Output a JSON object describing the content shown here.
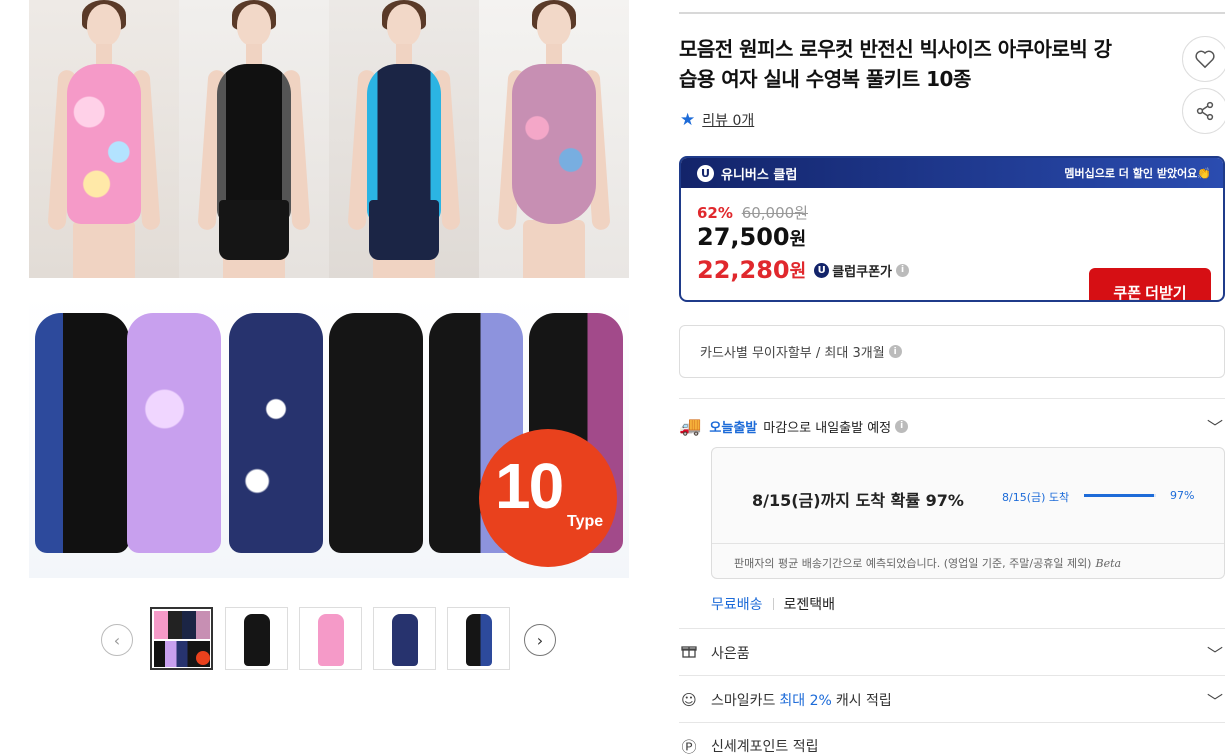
{
  "product": {
    "title_line1": "모음전 원피스 로우컷 반전신 빅사이즈 아쿠아로빅 강",
    "title_line2": "습용 여자 실내 수영복 풀키트 10종",
    "review_label": "리뷰 0개",
    "badge_number": "10",
    "badge_type": "Type"
  },
  "club": {
    "name": "유니버스 클럽",
    "promo": "멤버십으로 더 할인 받았어요👏",
    "discount_rate": "62%",
    "original_price": "60,000원",
    "sale_price": "27,500",
    "club_price": "22,280",
    "currency": "원",
    "club_coupon_label": "클럽쿠폰가",
    "coupon_button": "쿠폰 더받기"
  },
  "installment": {
    "text": "카드사별 무이자할부 / 최대 3개월"
  },
  "shipping": {
    "today_label": "오늘출발",
    "today_desc": "마감으로 내일출발 예정",
    "eta_main": "8/15(금)까지 도착 확률 97%",
    "eta_side_label": "8/15(금) 도착",
    "eta_percent_text": "97%",
    "eta_fill": 0.97,
    "eta_note": "판매자의 평균 배송기간으로 예측되었습니다. (영업일 기준, 주말/공휴일 제외)",
    "beta": "Beta",
    "free_label": "무료배송",
    "carrier": "로젠택배"
  },
  "accordions": {
    "gift": "사은품",
    "smile_prefix": "스마일카드",
    "smile_highlight": "최대 2%",
    "smile_suffix": "캐시 적립",
    "point": "신세계포인트 적립"
  },
  "icons": {
    "heart": "heart-icon",
    "share": "share-icon",
    "star": "star-icon",
    "truck": "truck-icon",
    "gift": "gift-icon",
    "smile": "smile-icon",
    "point": "point-icon",
    "chevron": "chevron-down-icon",
    "prev": "chevron-left-icon",
    "next": "chevron-right-icon"
  },
  "colors": {
    "accent_blue": "#1d6bd8",
    "sale_red": "#e0282d",
    "club_navy": "#13246a",
    "coupon_red": "#d60f14",
    "badge_orange": "#e9411d"
  }
}
